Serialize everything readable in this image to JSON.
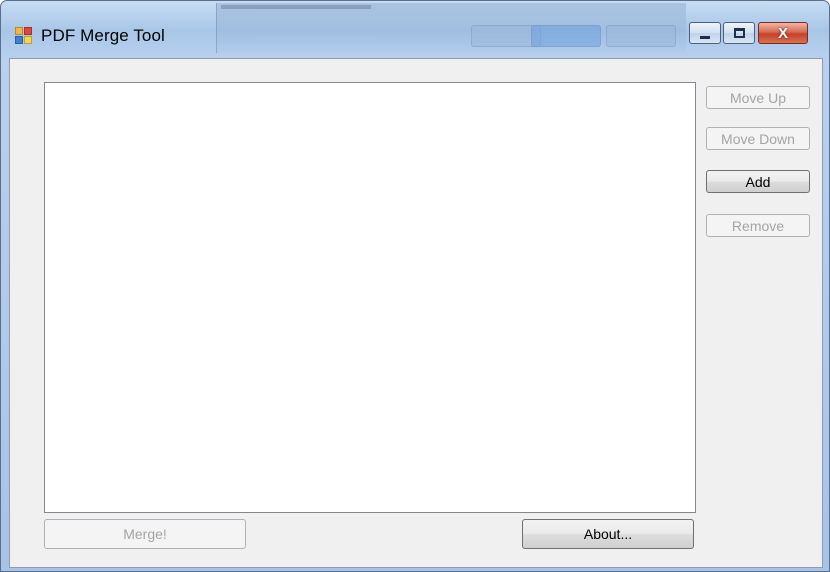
{
  "window": {
    "title": "PDF Merge Tool",
    "icon": "pdf-merge-app-icon",
    "controls": {
      "minimize_icon": "minimize-icon",
      "maximize_icon": "maximize-icon",
      "close_icon": "close-icon",
      "close_glyph": "X"
    }
  },
  "file_list": {
    "items": []
  },
  "side_buttons": {
    "move_up": "Move Up",
    "move_down": "Move Down",
    "add": "Add",
    "remove": "Remove"
  },
  "bottom_buttons": {
    "merge": "Merge!",
    "about": "About..."
  },
  "states": {
    "move_up_enabled": false,
    "move_down_enabled": false,
    "add_enabled": true,
    "remove_enabled": false,
    "merge_enabled": false,
    "about_enabled": true
  },
  "colors": {
    "titlebar": "#b9d1ee",
    "client_bg": "#f0f0f0",
    "close_button": "#c7402a",
    "disabled_text": "#a4a4a4"
  }
}
